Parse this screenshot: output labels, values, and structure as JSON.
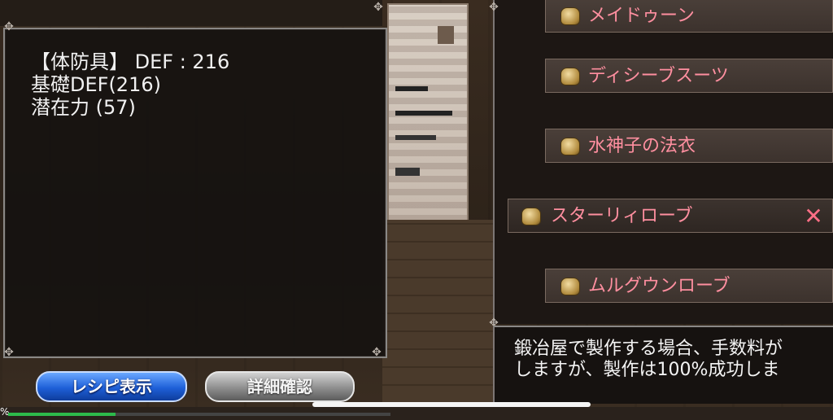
{
  "info_panel": {
    "line1": "【体防具】 DEF : 216",
    "line2": "基礎DEF(216)",
    "line3": "潜在力 (57)"
  },
  "buttons": {
    "recipe": "レシピ表示",
    "detail": "詳細確認"
  },
  "armor_list": {
    "items": [
      {
        "label": "メイドゥーン",
        "icon": "armor-icon"
      },
      {
        "label": "ディシーブスーツ",
        "icon": "armor-icon"
      },
      {
        "label": "水神子の法衣",
        "icon": "armor-icon"
      },
      {
        "label": "スターリィローブ",
        "icon": "armor-icon",
        "selected": true,
        "close_symbol": "✕"
      },
      {
        "label": "ムルグウンローブ",
        "icon": "armor-icon"
      }
    ]
  },
  "message": {
    "line1": "鍛冶屋で製作する場合、手数料が",
    "line2": "しますが、製作は100%成功しま"
  },
  "status": {
    "percent_symbol": "%",
    "progress_fraction": 0.28
  },
  "colors": {
    "item_text": "#ff8fa0",
    "recipe_button": "#1e5fd8",
    "detail_button": "#8e8e8e",
    "progress": "#2dbb4b"
  }
}
